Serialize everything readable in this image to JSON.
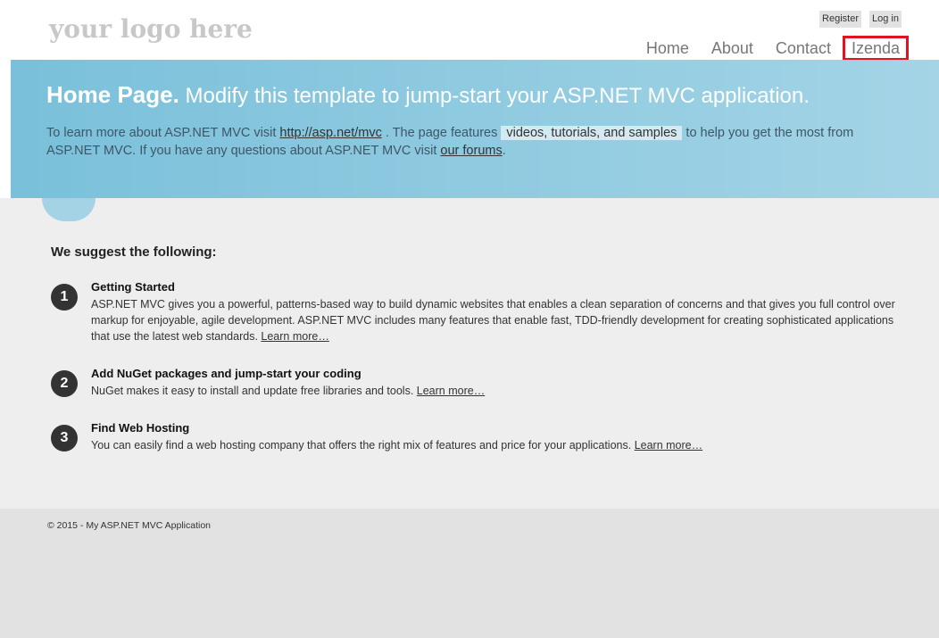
{
  "header": {
    "logo": "your logo here",
    "register": "Register",
    "login": "Log in",
    "nav": [
      "Home",
      "About",
      "Contact",
      "Izenda"
    ]
  },
  "featured": {
    "title_strong": "Home Page.",
    "title_rest": " Modify this template to jump-start your ASP.NET MVC application.",
    "text_1": "To learn more about ASP.NET MVC visit ",
    "link_1": "http://asp.net/mvc",
    "text_2": " . The page features ",
    "mark": "videos, tutorials, and samples",
    "text_3": " to help you get the most from ASP.NET MVC. If you have any questions about ASP.NET MVC visit ",
    "link_2": "our forums",
    "text_4": "."
  },
  "main": {
    "heading": "We suggest the following:",
    "items": [
      {
        "num": "1",
        "title": "Getting Started",
        "body": "ASP.NET MVC gives you a powerful, patterns-based way to build dynamic websites that enables a clean separation of concerns and that gives you full control over markup for enjoyable, agile development. ASP.NET MVC includes many features that enable fast, TDD-friendly development for creating sophisticated applications that use the latest web standards. ",
        "link": "Learn more…"
      },
      {
        "num": "2",
        "title": "Add NuGet packages and jump-start your coding",
        "body": "NuGet makes it easy to install and update free libraries and tools. ",
        "link": "Learn more…"
      },
      {
        "num": "3",
        "title": "Find Web Hosting",
        "body": "You can easily find a web hosting company that offers the right mix of features and price for your applications. ",
        "link": "Learn more…"
      }
    ]
  },
  "footer": {
    "copyright": "© 2015 - My ASP.NET MVC Application"
  },
  "colors": {
    "hero_start": "#7ac0da",
    "hero_end": "#a4d4e6",
    "highlight_border": "#e0141e",
    "body_bg": "#efeeef",
    "footer_bg": "#e2e2e2"
  }
}
